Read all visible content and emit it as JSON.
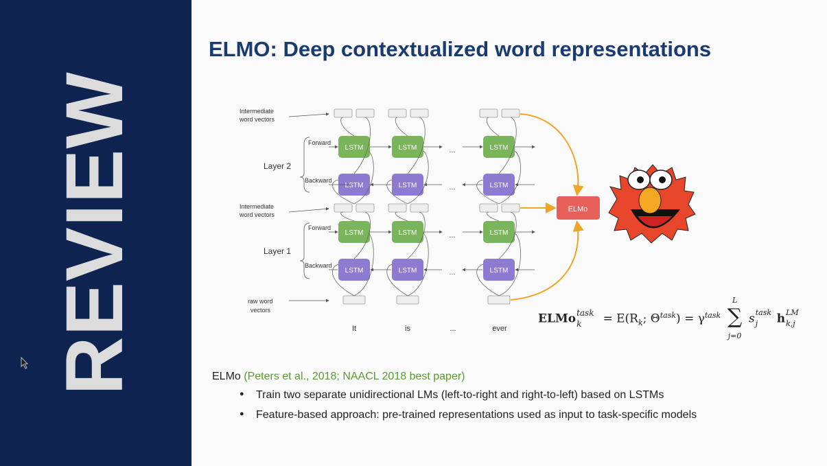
{
  "sidebar": {
    "word": "REVIEW"
  },
  "slide": {
    "title": "ELMO: Deep contextualized word representations",
    "diagram": {
      "row_labels": {
        "intermediate_top": [
          "Intermediate",
          "word vectors"
        ],
        "intermediate_mid": [
          "Intermediate",
          "word vectors"
        ],
        "raw": [
          "raw word",
          "vectors"
        ]
      },
      "layers": {
        "layer2": "Layer 2",
        "layer1": "Layer 1"
      },
      "directions": {
        "forward": "Forward",
        "backward": "Backward"
      },
      "cell": "LSTM",
      "ellipsis": "...",
      "tokens": [
        "It",
        "is",
        "...",
        "ever"
      ],
      "output": "ELMo",
      "colors": {
        "forward": "#7ab55c",
        "backward": "#8c7bd0",
        "elmo": "#e8605a",
        "arrow": "#f0a526"
      }
    },
    "equation": {
      "lhs": "ELMo",
      "lhs_sup": "task",
      "lhs_sub": "k",
      "eq1": "= E(R",
      "eq1_sub": "k",
      "eq1_mid": "; Θ",
      "eq1_sup": "task",
      "eq1_end": ") = γ",
      "gamma_sup": "task",
      "sum_top": "L",
      "sum_bottom": "j=0",
      "s": "s",
      "s_sup": "task",
      "s_sub": "j",
      "h": "h",
      "h_sup": "LM",
      "h_sub": "k,j"
    },
    "intro": {
      "label": "ELMo",
      "citation": "(Peters et al., 2018; NAACL 2018 best paper)"
    },
    "bullets": [
      "Train two separate unidirectional LMs (left-to-right and right-to-left) based on LSTMs",
      "Feature-based approach: pre-trained representations used as input to task-specific models"
    ]
  }
}
